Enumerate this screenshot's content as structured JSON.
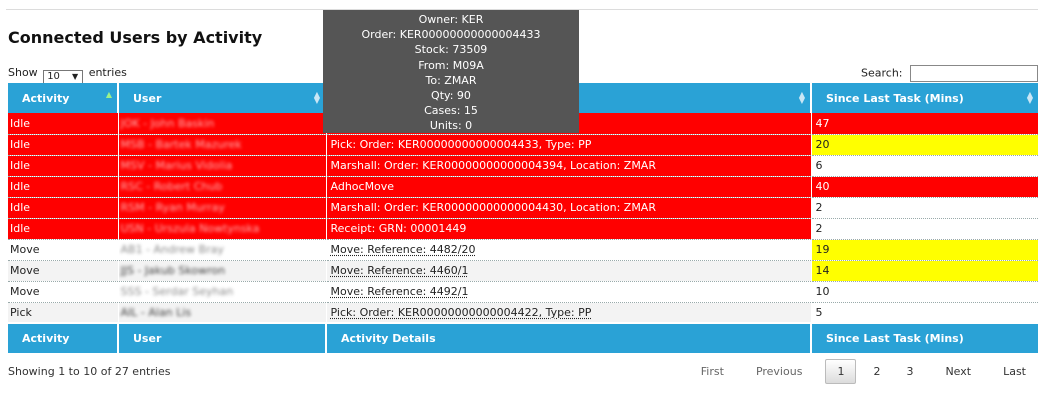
{
  "page": {
    "title": "Connected Users by Activity"
  },
  "length": {
    "prefix": "Show",
    "value": "10",
    "suffix": "entries"
  },
  "search": {
    "label": "Search:",
    "value": ""
  },
  "columns": [
    "Activity",
    "User",
    "Activity Details",
    "Since Last Task (Mins)"
  ],
  "rows": [
    {
      "activity": "Idle",
      "user": "JOK - John Baskin",
      "details": "",
      "since": "47",
      "row_style": "idle",
      "since_color": "red"
    },
    {
      "activity": "Idle",
      "user": "MSB - Bartek Mazurek",
      "details": "Pick: Order: KER00000000000004433, Type: PP",
      "since": "20",
      "row_style": "idle",
      "since_color": "yellow"
    },
    {
      "activity": "Idle",
      "user": "MSV - Marius Vidolia",
      "details": "Marshall: Order: KER00000000000004394, Location: ZMAR",
      "since": "6",
      "row_style": "idle",
      "since_color": "white"
    },
    {
      "activity": "Idle",
      "user": "RSC - Robert Chub",
      "details": "AdhocMove",
      "since": "40",
      "row_style": "idle",
      "since_color": "red"
    },
    {
      "activity": "Idle",
      "user": "RSM - Ryan Murray",
      "details": "Marshall: Order: KER00000000000004430, Location: ZMAR",
      "since": "2",
      "row_style": "idle",
      "since_color": "white"
    },
    {
      "activity": "Idle",
      "user": "USN - Urszula Nowtynska",
      "details": "Receipt: GRN: 00001449",
      "since": "2",
      "row_style": "idle",
      "since_color": "white"
    },
    {
      "activity": "Move",
      "user": "AB1 - Andrew Bray",
      "details": "Move: Reference: 4482/20",
      "since": "19",
      "row_style": "normal",
      "since_color": "yellow"
    },
    {
      "activity": "Move",
      "user": "JJS - Jakub Skowron",
      "details": "Move: Reference: 4460/1",
      "since": "14",
      "row_style": "alt",
      "since_color": "yellow"
    },
    {
      "activity": "Move",
      "user": "SSS - Serdar Seyhan",
      "details": "Move: Reference: 4492/1",
      "since": "10",
      "row_style": "normal",
      "since_color": "white"
    },
    {
      "activity": "Pick",
      "user": "AIL - Alan Lis",
      "details": "Pick: Order: KER00000000000004422, Type: PP",
      "since": "5",
      "row_style": "alt",
      "since_color": "white"
    }
  ],
  "info": "Showing 1 to 10 of 27 entries",
  "pagination": {
    "first": "First",
    "previous": "Previous",
    "pages": [
      "1",
      "2",
      "3"
    ],
    "current": "1",
    "next": "Next",
    "last": "Last"
  },
  "tooltip": {
    "lines": [
      "Owner: KER",
      "Order: KER00000000000004433",
      "Stock: 73509",
      "From: M09A",
      "To: ZMAR",
      "Qty: 90",
      "Cases: 15",
      "Units: 0"
    ]
  },
  "colors": {
    "header": "#2aa2d6",
    "idle_row": "#ff0000",
    "warn": "#ffff00",
    "tooltip_bg": "#555555"
  }
}
